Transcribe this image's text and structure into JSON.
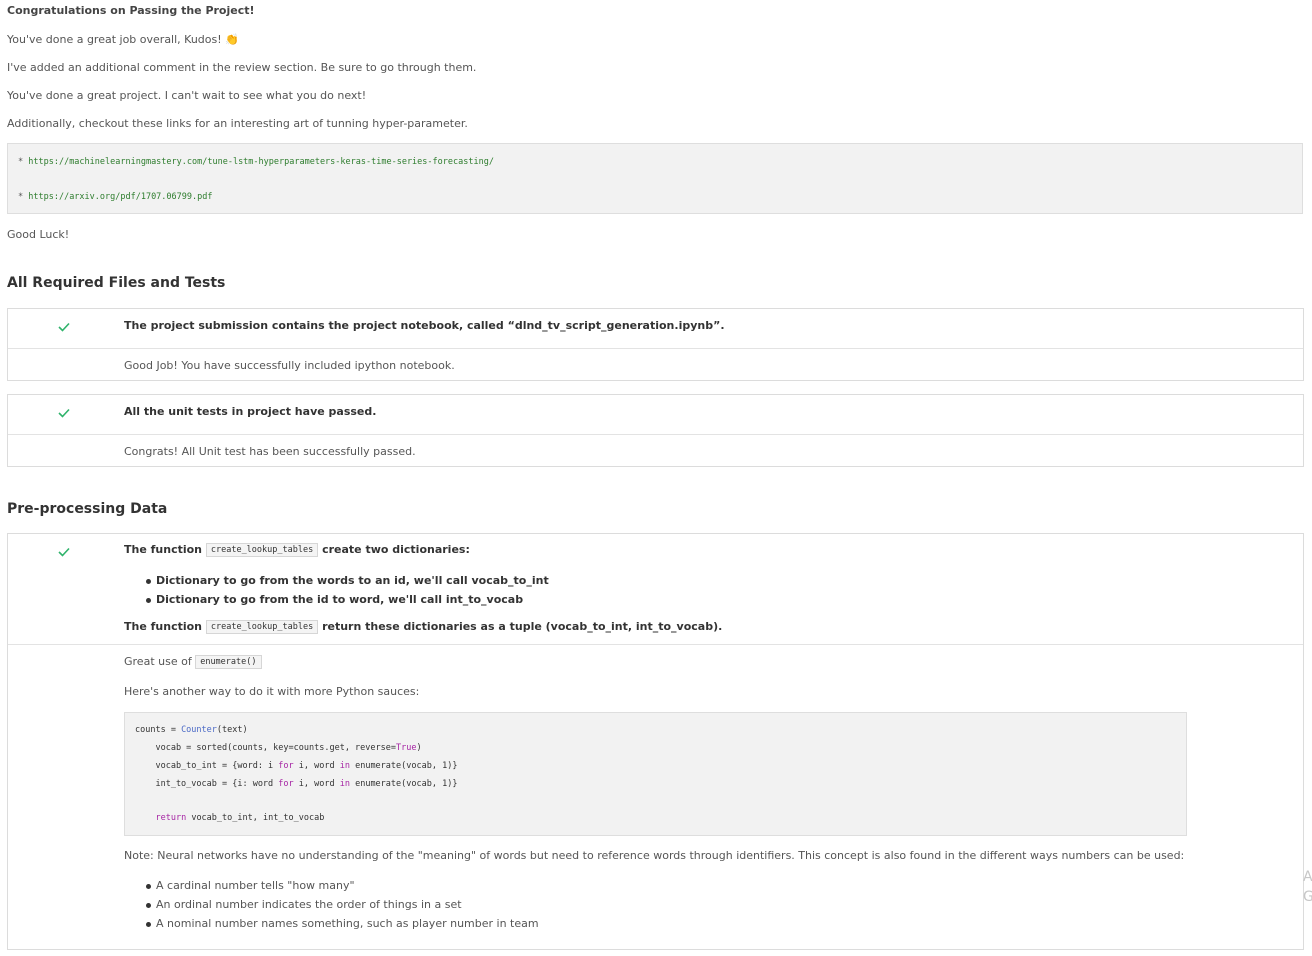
{
  "intro": {
    "title": "Congratulations on Passing the Project!",
    "line1": "You've done a great job overall, Kudos!",
    "line1_emoji": "👏",
    "line2": "I've added an additional comment in the review section. Be sure to go through them.",
    "line3": "You've done a great project. I can't wait to see what you do next!",
    "line4": "Additionally, checkout these links for an interesting art of tunning hyper-parameter.",
    "links": [
      "https://machinelearningmastery.com/tune-lstm-hyperparameters-keras-time-series-forecasting/",
      "https://arxiv.org/pdf/1707.06799.pdf"
    ],
    "link_bullet": "*",
    "closing": "Good Luck!"
  },
  "sections": {
    "files_tests": {
      "title": "All Required Files and Tests",
      "criteria": [
        {
          "status": "passed",
          "text": "The project submission contains the project notebook, called “dlnd_tv_script_generation.ipynb”.",
          "review": "Good Job! You have successfully included ipython notebook."
        },
        {
          "status": "passed",
          "text": "All the unit tests in project have passed.",
          "review": "Congrats! All Unit test has been successfully passed."
        }
      ]
    },
    "preprocessing": {
      "title": "Pre-processing Data",
      "criterion": {
        "status": "passed",
        "line1_pre": "The function",
        "line1_code": "create_lookup_tables",
        "line1_post": "create two dictionaries:",
        "bullets": [
          "Dictionary to go from the words to an id, we'll call vocab_to_int",
          "Dictionary to go from the id to word, we'll call int_to_vocab"
        ],
        "line2_pre": "The function",
        "line2_code": "create_lookup_tables",
        "line2_post": "return these dictionaries as a tuple (vocab_to_int, int_to_vocab)."
      },
      "review": {
        "great_use_pre": "Great use of",
        "great_use_code": "enumerate()",
        "another_way": "Here's another way to do it with more Python sauces:",
        "code_lines": [
          "counts = Counter(text)",
          "    vocab = sorted(counts, key=counts.get, reverse=True)",
          "    vocab_to_int = {word: i for i, word in enumerate(vocab, 1)}",
          "    int_to_vocab = {i: word for i, word in enumerate(vocab, 1)}",
          "",
          "    return vocab_to_int, int_to_vocab"
        ],
        "note": "Note: Neural networks have no understanding of the \"meaning\" of words but need to reference words through identifiers. This concept is also found in the different ways numbers can be used:",
        "note_bullets": [
          "A cardinal number tells \"how many\"",
          "An ordinal number indicates the order of things in a set",
          "A nominal number names something, such as player number in team"
        ]
      }
    }
  },
  "edge_clipped_text": [
    "A",
    "G"
  ],
  "colors": {
    "check": "#2fb36b",
    "code_bg": "#f2f2f2",
    "border": "#dcdcdc",
    "link_green": "#2e7d2e"
  }
}
